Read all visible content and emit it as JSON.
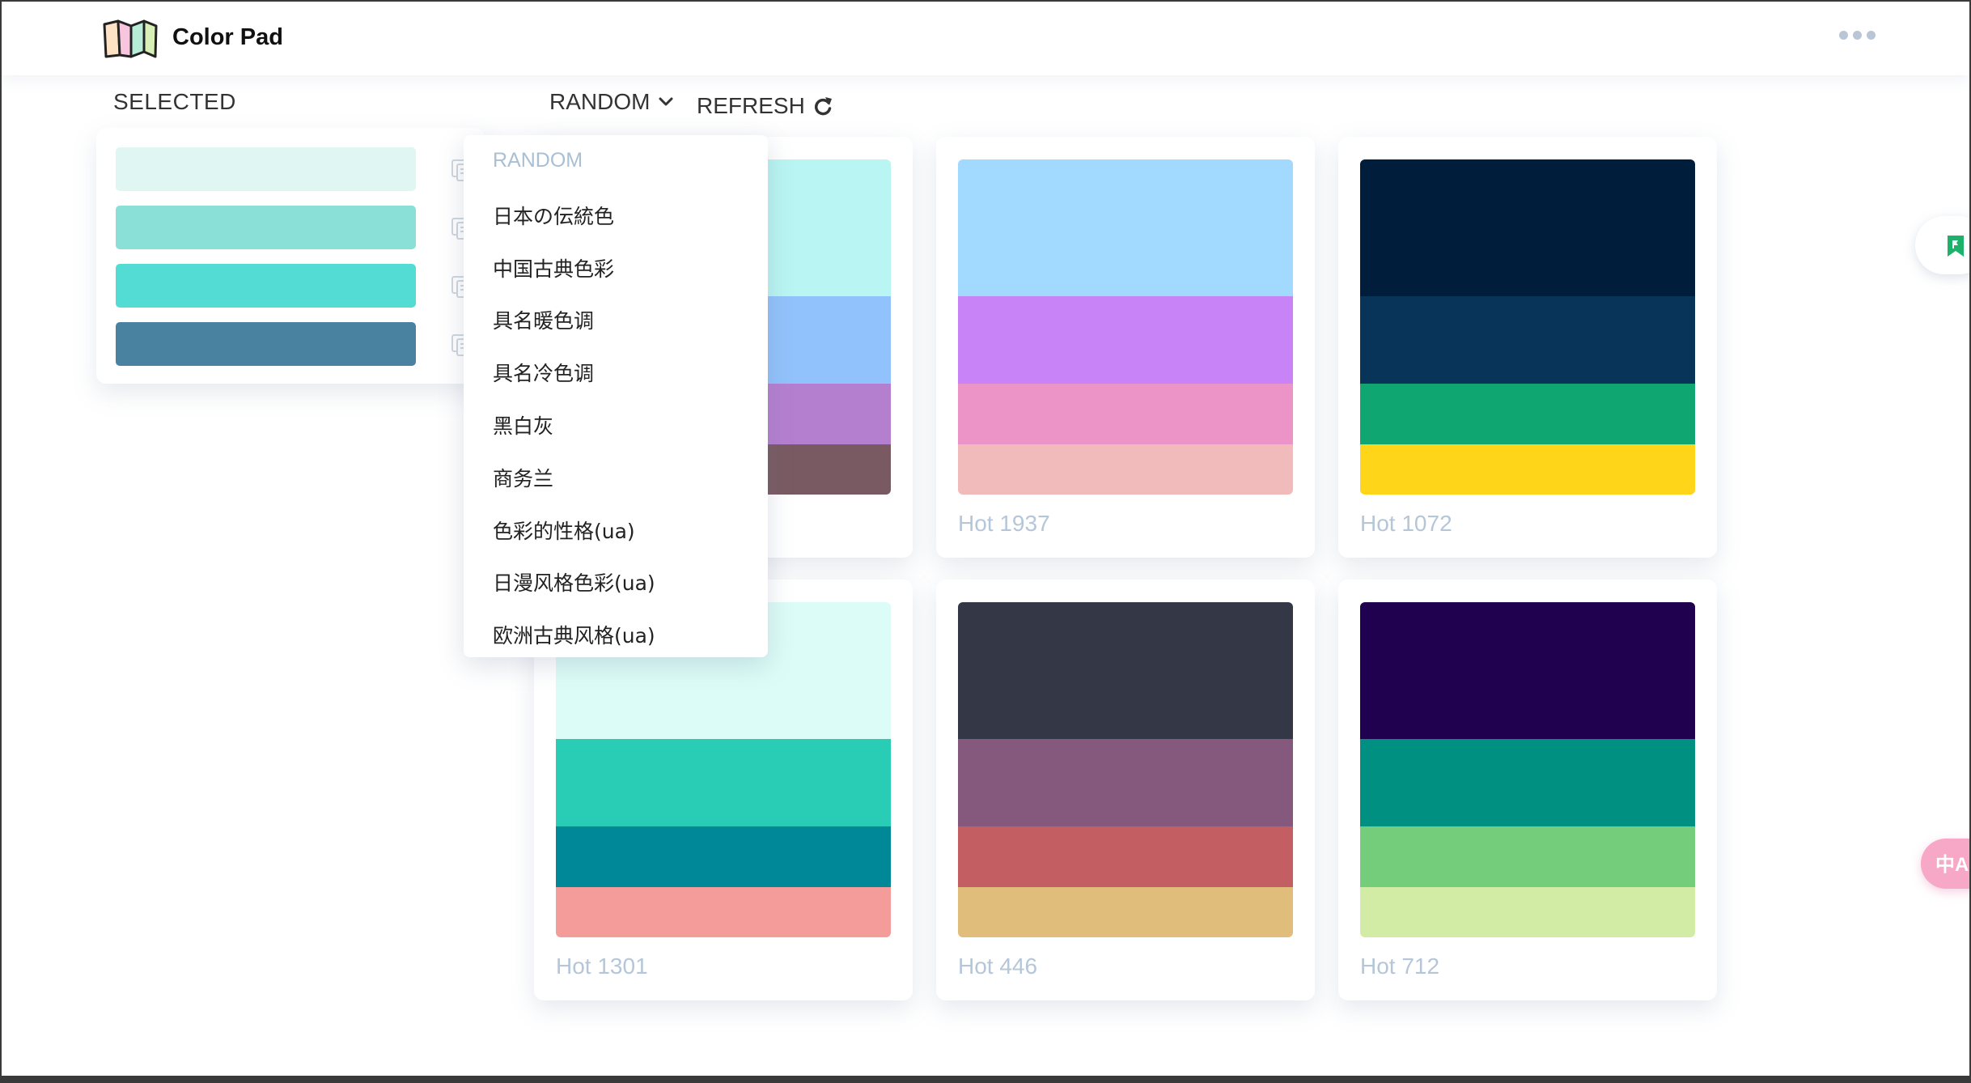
{
  "app": {
    "title": "Color Pad"
  },
  "selected": {
    "title": "SELECTED",
    "colors": [
      "#e0f6f2",
      "#8ae0d7",
      "#53dcd3",
      "#4882a0"
    ]
  },
  "toolbar": {
    "random_label": "RANDOM",
    "refresh_label": "REFRESH"
  },
  "dropdown": {
    "items": [
      {
        "label": "RANDOM",
        "active": true
      },
      {
        "label": "日本の伝統色",
        "active": false
      },
      {
        "label": "中国古典色彩",
        "active": false
      },
      {
        "label": "具名暖色调",
        "active": false
      },
      {
        "label": "具名冷色调",
        "active": false
      },
      {
        "label": "黑白灰",
        "active": false
      },
      {
        "label": "商务兰",
        "active": false
      },
      {
        "label": "色彩的性格(ua)",
        "active": false
      },
      {
        "label": "日漫风格色彩(ua)",
        "active": false
      },
      {
        "label": "欧洲古典风格(ua)",
        "active": false
      }
    ]
  },
  "palettes": [
    {
      "label": "",
      "colors": [
        "#b9f5f2",
        "#92c2fb",
        "#b57fd0",
        "#7a5a62"
      ]
    },
    {
      "label": "Hot 1937",
      "colors": [
        "#a2d9fe",
        "#c883f6",
        "#ec93c8",
        "#f1bbbc"
      ]
    },
    {
      "label": "Hot 1072",
      "colors": [
        "#001e3c",
        "#08345a",
        "#0fa672",
        "#fed519"
      ]
    },
    {
      "label": "Hot 1301",
      "colors": [
        "#dcfcf7",
        "#29cdb5",
        "#008798",
        "#f39c99"
      ]
    },
    {
      "label": "Hot 446",
      "colors": [
        "#343746",
        "#84597d",
        "#c35f63",
        "#e1bd7c"
      ]
    },
    {
      "label": "Hot 712",
      "colors": [
        "#1f0150",
        "#009081",
        "#74cd7b",
        "#d2eca6"
      ]
    }
  ],
  "icons": {
    "logo": "book-palette-icon",
    "more": "more-dots-icon",
    "copy": "copy-icon",
    "dropdown": "chevron-down-icon",
    "refresh": "refresh-icon",
    "bookmark": "bookmark-icon",
    "translate": "translate-icon"
  },
  "colors": {
    "accent_bookmark": "#1db26b",
    "translate_button": "#f6a8c6",
    "muted_label": "#b5c6d8"
  }
}
